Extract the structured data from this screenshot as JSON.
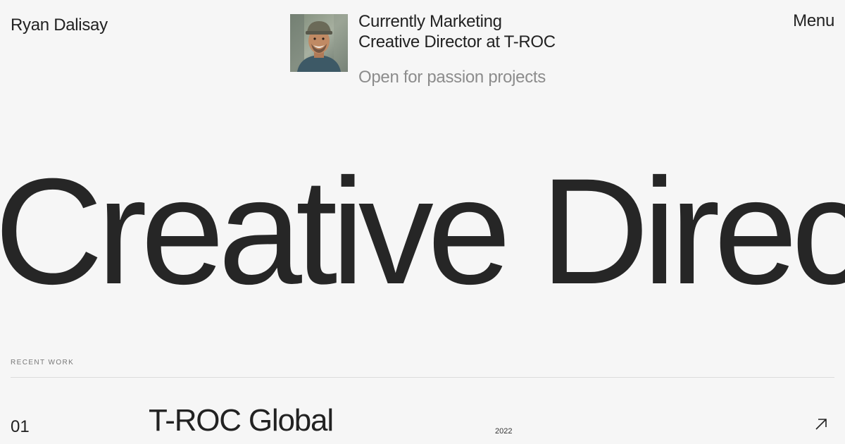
{
  "header": {
    "brand": "Ryan Dalisay",
    "menu_label": "Menu"
  },
  "status": {
    "line1": "Currently Marketing",
    "line2": "Creative Director at T-ROC",
    "availability": "Open for passion projects"
  },
  "hero": {
    "text": "Creative Director"
  },
  "recent_work": {
    "label": "RECENT WORK",
    "items": [
      {
        "index": "01",
        "title": "T-ROC Global",
        "year": "2022",
        "icon": "arrow-up-right-icon"
      }
    ]
  },
  "colors": {
    "background": "#f6f6f6",
    "text": "#222222",
    "muted": "#8c8c8c",
    "rule": "#dcdcdc"
  }
}
